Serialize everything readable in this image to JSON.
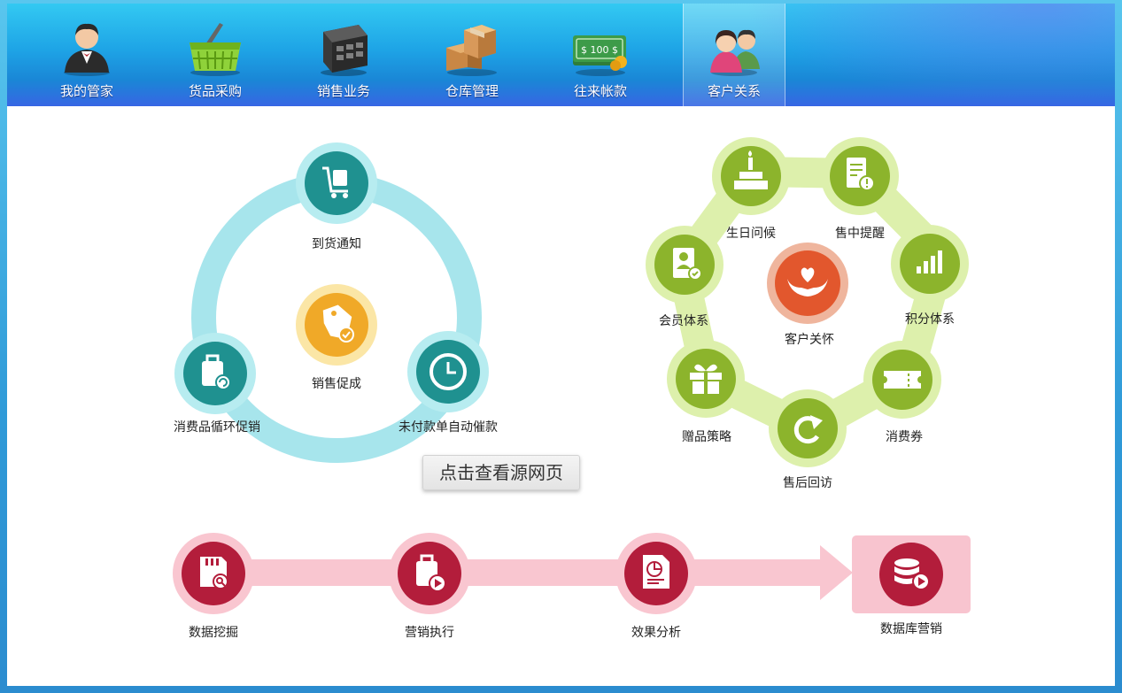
{
  "nav": {
    "items": [
      {
        "label": "我的管家",
        "icon": "butler-icon"
      },
      {
        "label": "货品采购",
        "icon": "basket-icon"
      },
      {
        "label": "销售业务",
        "icon": "register-icon"
      },
      {
        "label": "仓库管理",
        "icon": "boxes-icon"
      },
      {
        "label": "往来帐款",
        "icon": "money-icon"
      },
      {
        "label": "客户关系",
        "icon": "customers-icon"
      }
    ],
    "active": "客户关系",
    "money_text": "$ 100 $"
  },
  "sales_cycle": {
    "center": "销售促成",
    "nodes": [
      "到货通知",
      "消费品循环促销",
      "未付款单自动催款"
    ]
  },
  "care_ring": {
    "center": "客户关怀",
    "nodes": [
      "生日问候",
      "售中提醒",
      "积分体系",
      "消费券",
      "售后回访",
      "赠品策略",
      "会员体系"
    ]
  },
  "tooltip": "点击查看源网页",
  "pipeline": {
    "steps": [
      "数据挖掘",
      "营销执行",
      "效果分析"
    ],
    "final": "数据库营销"
  },
  "colors": {
    "teal_ring": "#a4e6ec",
    "teal_node": "#1f9190",
    "orange_center": "#f0a928",
    "green_ring": "#dcf0a8",
    "green_node": "#8cb42c",
    "care_center": "#e2572d",
    "pink_band": "#f8c4cf",
    "crimson_node": "#b31d3b"
  }
}
